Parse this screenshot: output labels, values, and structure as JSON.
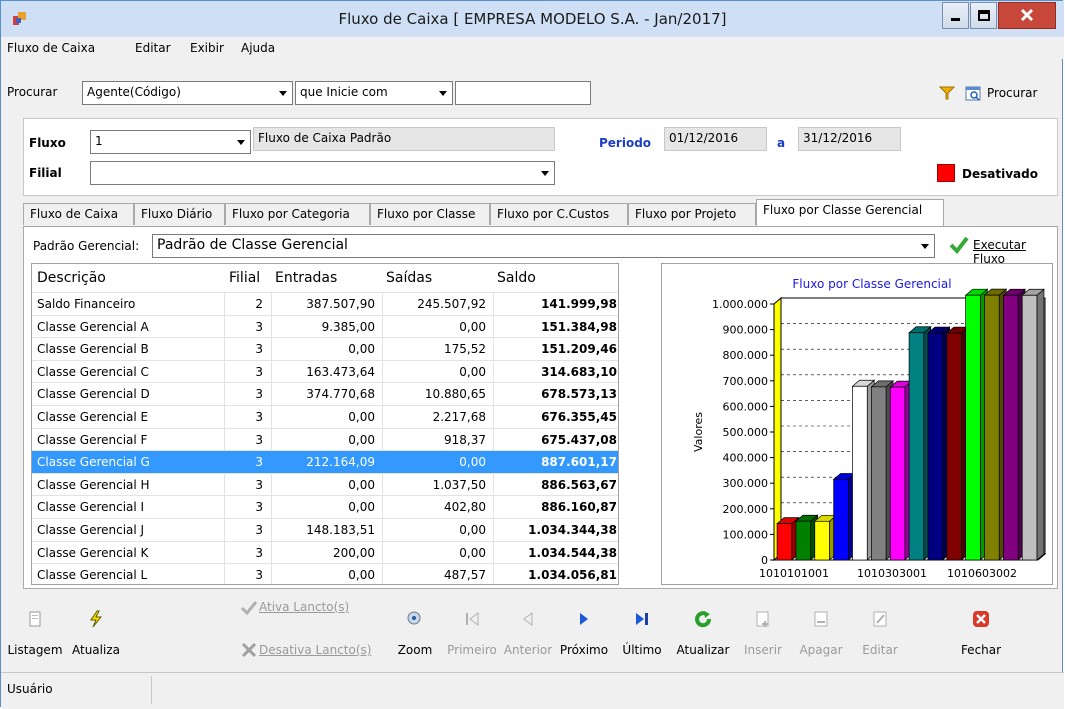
{
  "window": {
    "title": "Fluxo de Caixa [ EMPRESA MODELO S.A.  - Jan/2017]",
    "controls": {
      "minimize": "minimize-icon",
      "maximize": "maximize-icon",
      "close": "close-icon"
    }
  },
  "menu": [
    "Fluxo de Caixa",
    "Editar",
    "Exibir",
    "Ajuda"
  ],
  "search": {
    "label": "Procurar",
    "field_value": "Agente(Código)",
    "operator_value": "que Inicie com",
    "text_value": "",
    "button_label": "Procurar"
  },
  "header": {
    "fluxo_label": "Fluxo",
    "fluxo_value": "1",
    "fluxo_desc": "Fluxo de Caixa Padrão",
    "filial_label": "Filial",
    "filial_value": "",
    "periodo_label": "Periodo",
    "periodo_from": "01/12/2016",
    "periodo_sep": "a",
    "periodo_to": "31/12/2016",
    "status_label": "Desativado",
    "status_color": "#ff0000"
  },
  "tabs": [
    "Fluxo de Caixa",
    "Fluxo Diário",
    "Fluxo por Categoria",
    "Fluxo por Classe",
    "Fluxo por C.Custos",
    "Fluxo por Projeto",
    "Fluxo por Classe Gerencial"
  ],
  "active_tab": "Fluxo por Classe Gerencial",
  "gerencial": {
    "label": "Padrão Gerencial:",
    "value": "Padrão de Classe Gerencial",
    "execute_label": "Executar Fluxo"
  },
  "table": {
    "headers": [
      "Descrição",
      "Filial",
      "Entradas",
      "Saídas",
      "Saldo"
    ],
    "rows": [
      [
        "Saldo Financeiro",
        "2",
        "387.507,90",
        "245.507,92",
        "141.999,98"
      ],
      [
        "Classe Gerencial A",
        "3",
        "9.385,00",
        "0,00",
        "151.384,98"
      ],
      [
        "Classe Gerencial B",
        "3",
        "0,00",
        "175,52",
        "151.209,46"
      ],
      [
        "Classe Gerencial C",
        "3",
        "163.473,64",
        "0,00",
        "314.683,10"
      ],
      [
        "Classe Gerencial D",
        "3",
        "374.770,68",
        "10.880,65",
        "678.573,13"
      ],
      [
        "Classe Gerencial E",
        "3",
        "0,00",
        "2.217,68",
        "676.355,45"
      ],
      [
        "Classe Gerencial F",
        "3",
        "0,00",
        "918,37",
        "675.437,08"
      ],
      [
        "Classe Gerencial G",
        "3",
        "212.164,09",
        "0,00",
        "887.601,17"
      ],
      [
        "Classe Gerencial H",
        "3",
        "0,00",
        "1.037,50",
        "886.563,67"
      ],
      [
        "Classe Gerencial I",
        "3",
        "0,00",
        "402,80",
        "886.160,87"
      ],
      [
        "Classe Gerencial J",
        "3",
        "148.183,51",
        "0,00",
        "1.034.344,38"
      ],
      [
        "Classe Gerencial K",
        "3",
        "200,00",
        "0,00",
        "1.034.544,38"
      ],
      [
        "Classe Gerencial L",
        "3",
        "0,00",
        "487,57",
        "1.034.056,81"
      ]
    ],
    "selected_index": 7
  },
  "chart_data": {
    "type": "bar",
    "title": "Fluxo por Classe Gerencial",
    "ylabel": "Valores",
    "xlabel": "",
    "ylim": [
      0,
      1000000
    ],
    "yticks": [
      "0",
      "100.000",
      "200.000",
      "300.000",
      "400.000",
      "500.000",
      "600.000",
      "700.000",
      "800.000",
      "900.000",
      "1.000.000"
    ],
    "xtick_labels": [
      "1010101001",
      "1010303001",
      "1010603002"
    ],
    "values": [
      141999.98,
      151384.98,
      151209.46,
      314683.1,
      678573.13,
      676355.45,
      675437.08,
      887601.17,
      886563.67,
      886160.87,
      1034344.38,
      1034544.38,
      1034056.81
    ],
    "colors": [
      "#ff0000",
      "#008000",
      "#ffff00",
      "#0000ff",
      "#ffffff",
      "#808080",
      "#ff00ff",
      "#008080",
      "#000080",
      "#800000",
      "#00ff00",
      "#808000",
      "#800080",
      "#c0c0c0"
    ],
    "grid": true,
    "legend": "none"
  },
  "toolbar": [
    {
      "name": "listagem",
      "label": "Listagem",
      "icon": "page-icon",
      "enabled": true
    },
    {
      "name": "atualiza",
      "label": "Atualiza",
      "icon": "lightning-icon",
      "enabled": true
    },
    {
      "name": "ativa",
      "label": "Ativa Lancto(s)",
      "icon": "check-icon",
      "enabled": false
    },
    {
      "name": "desativa",
      "label": "Desativa Lancto(s)",
      "icon": "x-icon",
      "enabled": false
    },
    {
      "name": "zoom",
      "label": "Zoom",
      "icon": "zoom-icon",
      "enabled": true
    },
    {
      "name": "primeiro",
      "label": "Primeiro",
      "icon": "first-icon",
      "enabled": false
    },
    {
      "name": "anterior",
      "label": "Anterior",
      "icon": "prev-icon",
      "enabled": false
    },
    {
      "name": "proximo",
      "label": "Próximo",
      "icon": "next-icon",
      "enabled": true
    },
    {
      "name": "ultimo",
      "label": "Último",
      "icon": "last-icon",
      "enabled": true
    },
    {
      "name": "atualizar",
      "label": "Atualizar",
      "icon": "refresh-icon",
      "enabled": true
    },
    {
      "name": "inserir",
      "label": "Inserir",
      "icon": "insert-icon",
      "enabled": false
    },
    {
      "name": "apagar",
      "label": "Apagar",
      "icon": "delete-icon",
      "enabled": false
    },
    {
      "name": "editar",
      "label": "Editar",
      "icon": "edit-icon",
      "enabled": false
    },
    {
      "name": "fechar",
      "label": "Fechar",
      "icon": "close-red-icon",
      "enabled": true
    }
  ],
  "status": {
    "user_label": "Usuário"
  }
}
